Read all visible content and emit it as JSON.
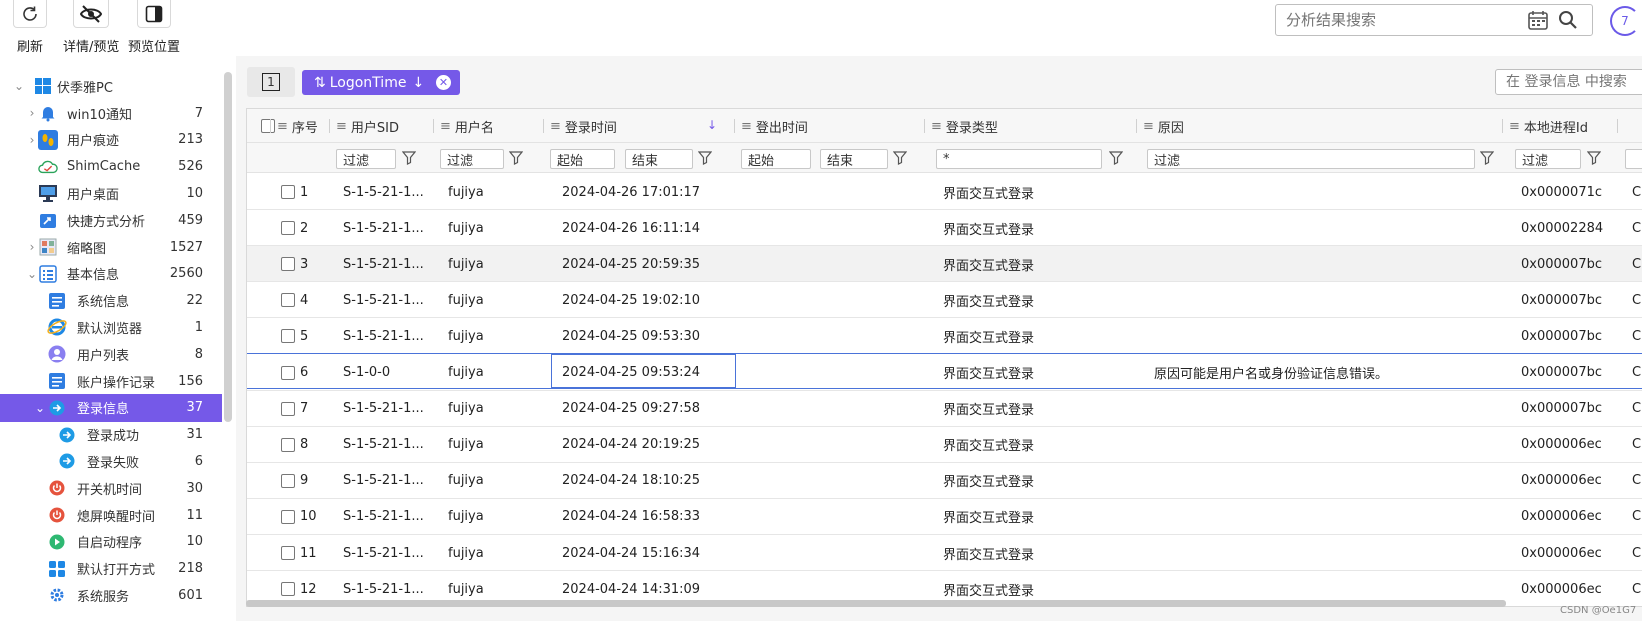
{
  "toolbar": {
    "refresh_label": "刷新",
    "details_label": "详情/预览",
    "preview_pos_label": "预览位置",
    "search_placeholder": "分析结果搜索",
    "spinner_text": "7"
  },
  "sidebar": {
    "root": {
      "label": "伏季雅PC"
    },
    "items": [
      {
        "label": "win10通知",
        "count": "7"
      },
      {
        "label": "用户痕迹",
        "count": "213"
      },
      {
        "label": "ShimCache",
        "count": "526"
      },
      {
        "label": "用户桌面",
        "count": "10"
      },
      {
        "label": "快捷方式分析",
        "count": "459"
      },
      {
        "label": "缩略图",
        "count": "1527"
      },
      {
        "label": "基本信息",
        "count": "2560"
      },
      {
        "label": "系统信息",
        "count": "22"
      },
      {
        "label": "默认浏览器",
        "count": "1"
      },
      {
        "label": "用户列表",
        "count": "8"
      },
      {
        "label": "账户操作记录",
        "count": "156"
      },
      {
        "label": "登录信息",
        "count": "37"
      },
      {
        "label": "登录成功",
        "count": "31"
      },
      {
        "label": "登录失败",
        "count": "6"
      },
      {
        "label": "开关机时间",
        "count": "30"
      },
      {
        "label": "熄屏唤醒时间",
        "count": "11"
      },
      {
        "label": "自启动程序",
        "count": "10"
      },
      {
        "label": "默认打开方式",
        "count": "218"
      },
      {
        "label": "系统服务",
        "count": "601"
      }
    ]
  },
  "main": {
    "page_button": "1",
    "sort_tag": "LogonTime",
    "search_placeholder": "在 登录信息 中搜索",
    "columns": [
      "序号",
      "用户SID",
      "用户名",
      "登录时间",
      "登出时间",
      "登录类型",
      "原因",
      "本地进程Id"
    ],
    "filters": {
      "filter_ph": "过滤",
      "start_ph": "起始",
      "end_ph": "结束",
      "logon_type_value": "*"
    },
    "rows": [
      {
        "n": "1",
        "sid": "S-1-5-21-1...",
        "user": "fujiya",
        "logon": "2024-04-26 17:01:17",
        "logoff": "",
        "type": "界面交互式登录",
        "reason": "",
        "pid": "0x0000071c"
      },
      {
        "n": "2",
        "sid": "S-1-5-21-1...",
        "user": "fujiya",
        "logon": "2024-04-26 16:11:14",
        "logoff": "",
        "type": "界面交互式登录",
        "reason": "",
        "pid": "0x00002284"
      },
      {
        "n": "3",
        "sid": "S-1-5-21-1...",
        "user": "fujiya",
        "logon": "2024-04-25 20:59:35",
        "logoff": "",
        "type": "界面交互式登录",
        "reason": "",
        "pid": "0x000007bc"
      },
      {
        "n": "4",
        "sid": "S-1-5-21-1...",
        "user": "fujiya",
        "logon": "2024-04-25 19:02:10",
        "logoff": "",
        "type": "界面交互式登录",
        "reason": "",
        "pid": "0x000007bc"
      },
      {
        "n": "5",
        "sid": "S-1-5-21-1...",
        "user": "fujiya",
        "logon": "2024-04-25 09:53:30",
        "logoff": "",
        "type": "界面交互式登录",
        "reason": "",
        "pid": "0x000007bc"
      },
      {
        "n": "6",
        "sid": "S-1-0-0",
        "user": "fujiya",
        "logon": "2024-04-25 09:53:24",
        "logoff": "",
        "type": "界面交互式登录",
        "reason": "原因可能是用户名或身份验证信息错误。",
        "pid": "0x000007bc"
      },
      {
        "n": "7",
        "sid": "S-1-5-21-1...",
        "user": "fujiya",
        "logon": "2024-04-25 09:27:58",
        "logoff": "",
        "type": "界面交互式登录",
        "reason": "",
        "pid": "0x000007bc"
      },
      {
        "n": "8",
        "sid": "S-1-5-21-1...",
        "user": "fujiya",
        "logon": "2024-04-24 20:19:25",
        "logoff": "",
        "type": "界面交互式登录",
        "reason": "",
        "pid": "0x000006ec"
      },
      {
        "n": "9",
        "sid": "S-1-5-21-1...",
        "user": "fujiya",
        "logon": "2024-04-24 18:10:25",
        "logoff": "",
        "type": "界面交互式登录",
        "reason": "",
        "pid": "0x000006ec"
      },
      {
        "n": "10",
        "sid": "S-1-5-21-1...",
        "user": "fujiya",
        "logon": "2024-04-24 16:58:33",
        "logoff": "",
        "type": "界面交互式登录",
        "reason": "",
        "pid": "0x000006ec"
      },
      {
        "n": "11",
        "sid": "S-1-5-21-1...",
        "user": "fujiya",
        "logon": "2024-04-24 15:16:34",
        "logoff": "",
        "type": "界面交互式登录",
        "reason": "",
        "pid": "0x000006ec"
      },
      {
        "n": "12",
        "sid": "S-1-5-21-1...",
        "user": "fujiya",
        "logon": "2024-04-24 14:31:09",
        "logoff": "",
        "type": "界面交互式登录",
        "reason": "",
        "pid": "0x000006ec"
      }
    ],
    "next_col_partial": "C:"
  },
  "watermark": "CSDN @Oe1G7",
  "colors": {
    "accent": "#7559e8",
    "focus": "#4a73d9"
  }
}
